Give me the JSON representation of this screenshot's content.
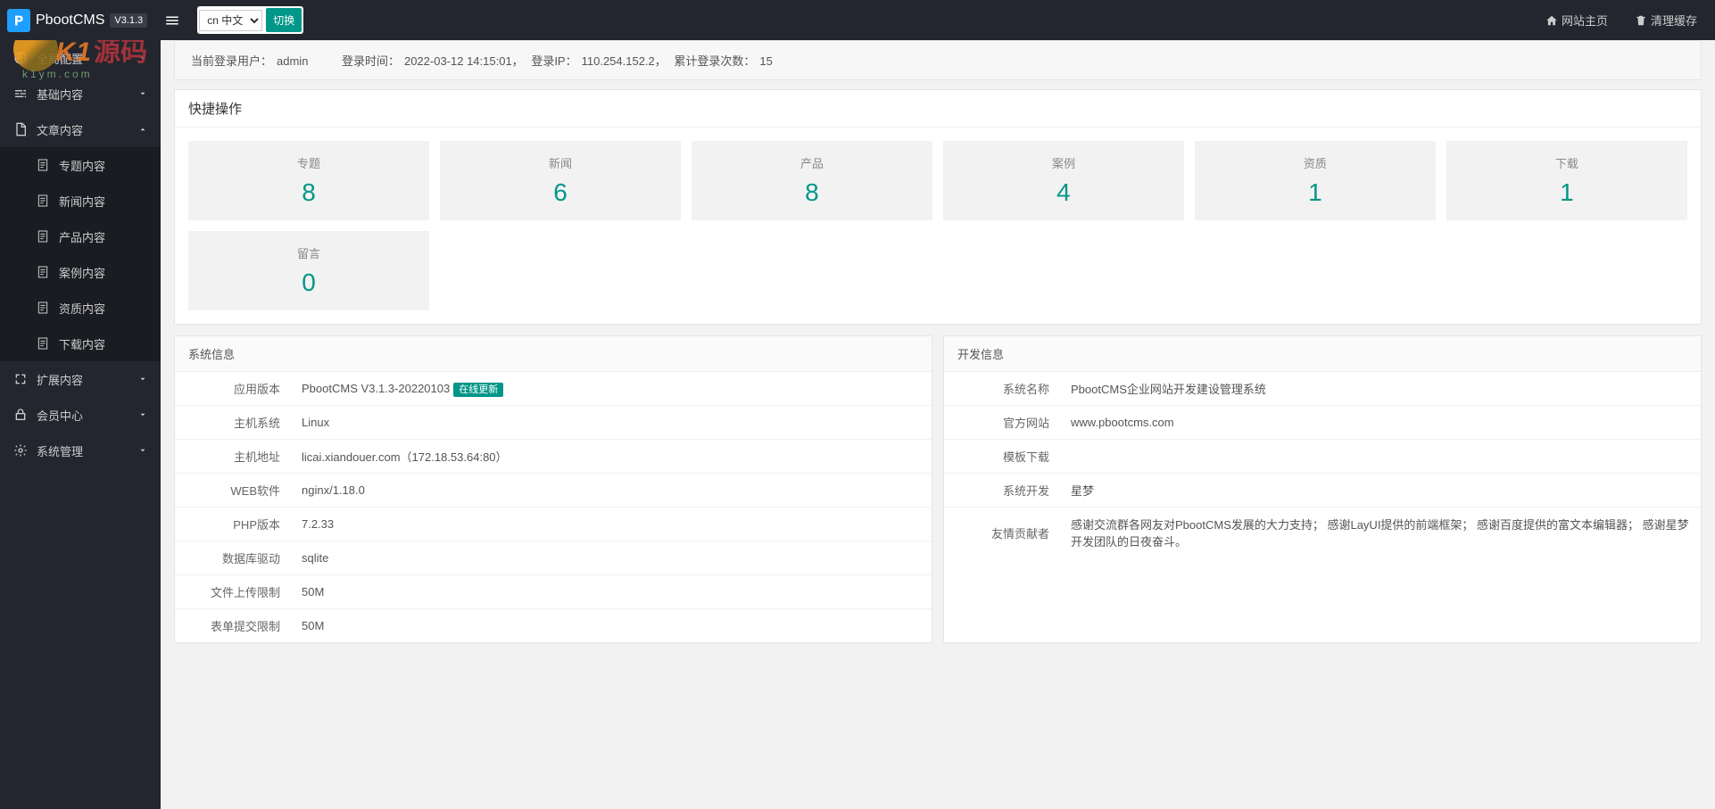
{
  "header": {
    "brand": "PbootCMS",
    "version": "V3.1.3",
    "lang_options": [
      "cn 中文"
    ],
    "lang_selected": "cn 中文",
    "lang_switch": "切换",
    "site_home": "网站主页",
    "clear_cache": "清理缓存"
  },
  "sidebar": {
    "items": [
      {
        "label": "全局配置",
        "expanded": false
      },
      {
        "label": "基础内容",
        "expanded": false
      },
      {
        "label": "文章内容",
        "expanded": true,
        "children": [
          {
            "label": "专题内容"
          },
          {
            "label": "新闻内容"
          },
          {
            "label": "产品内容"
          },
          {
            "label": "案例内容"
          },
          {
            "label": "资质内容"
          },
          {
            "label": "下载内容"
          }
        ]
      },
      {
        "label": "扩展内容",
        "expanded": false
      },
      {
        "label": "会员中心",
        "expanded": false
      },
      {
        "label": "系统管理",
        "expanded": false
      }
    ]
  },
  "infobar": {
    "user_label": "当前登录用户：",
    "user": "admin",
    "login_time_label": "登录时间：",
    "login_time": "2022-03-12 14:15:01，",
    "login_ip_label": "登录IP：",
    "login_ip": "110.254.152.2，",
    "login_count_label": "累计登录次数：",
    "login_count": "15"
  },
  "quick": {
    "title": "快捷操作",
    "cards": [
      {
        "title": "专题",
        "num": "8"
      },
      {
        "title": "新闻",
        "num": "6"
      },
      {
        "title": "产品",
        "num": "8"
      },
      {
        "title": "案例",
        "num": "4"
      },
      {
        "title": "资质",
        "num": "1"
      },
      {
        "title": "下载",
        "num": "1"
      },
      {
        "title": "留言",
        "num": "0"
      }
    ]
  },
  "sysinfo": {
    "title": "系统信息",
    "rows": [
      {
        "label": "应用版本",
        "value": "PbootCMS V3.1.3-20220103",
        "badge": "在线更新"
      },
      {
        "label": "主机系统",
        "value": "Linux"
      },
      {
        "label": "主机地址",
        "value": "licai.xiandouer.com（172.18.53.64:80）"
      },
      {
        "label": "WEB软件",
        "value": "nginx/1.18.0"
      },
      {
        "label": "PHP版本",
        "value": "7.2.33"
      },
      {
        "label": "数据库驱动",
        "value": "sqlite"
      },
      {
        "label": "文件上传限制",
        "value": "50M"
      },
      {
        "label": "表单提交限制",
        "value": "50M"
      }
    ]
  },
  "devinfo": {
    "title": "开发信息",
    "rows": [
      {
        "label": "系统名称",
        "value": "PbootCMS企业网站开发建设管理系统"
      },
      {
        "label": "官方网站",
        "value": "www.pbootcms.com"
      },
      {
        "label": "模板下载",
        "value": ""
      },
      {
        "label": "系统开发",
        "value": "星梦"
      },
      {
        "label": "友情贡献者",
        "value": "感谢交流群各网友对PbootCMS发展的大力支持； 感谢LayUI提供的前端框架； 感谢百度提供的富文本编辑器； 感谢星梦开发团队的日夜奋斗。"
      }
    ]
  },
  "watermark": {
    "k1": "K1",
    "cn": "源码",
    "url": "k1ym.com"
  }
}
